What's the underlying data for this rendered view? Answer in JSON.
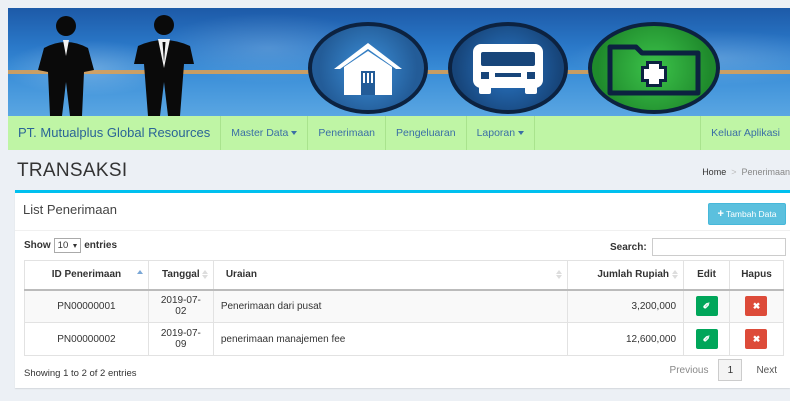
{
  "banner": {
    "icons": [
      "house-icon",
      "bus-icon",
      "folder-plus-icon"
    ],
    "colors": {
      "sky": "#2a78c8",
      "house_circle": "#235c98",
      "bus_circle": "#17457a",
      "folder_circle": "#1f8a2c",
      "ring": "#0c2240"
    }
  },
  "navbar": {
    "brand": "PT. Mutualplus Global Resources",
    "items": [
      {
        "label": "Master Data",
        "dropdown": true
      },
      {
        "label": "Penerimaan",
        "dropdown": false
      },
      {
        "label": "Pengeluaran",
        "dropdown": false
      },
      {
        "label": "Laporan",
        "dropdown": true
      }
    ],
    "logout": "Keluar Aplikasi",
    "background": "#bff5a5"
  },
  "header": {
    "title": "TRANSAKSI",
    "breadcrumb": {
      "home": "Home",
      "current": "Penerimaan"
    }
  },
  "box": {
    "title": "List Penerimaan",
    "add_button": "Tambah Data",
    "accent": "#00c0ef"
  },
  "table_controls": {
    "show_label": "Show",
    "entries_value": "10",
    "entries_label": "entries",
    "search_label": "Search:"
  },
  "table": {
    "columns": [
      "ID Penerimaan",
      "Tanggal",
      "Uraian",
      "Jumlah Rupiah",
      "Edit",
      "Hapus"
    ],
    "rows": [
      {
        "id": "PN00000001",
        "tanggal": "2019-07-02",
        "uraian": "Penerimaan dari pusat",
        "jumlah": "3,200,000"
      },
      {
        "id": "PN00000002",
        "tanggal": "2019-07-09",
        "uraian": "penerimaan manajemen fee",
        "jumlah": "12,600,000"
      }
    ],
    "edit_color": "#00a65a",
    "delete_color": "#dd4b39"
  },
  "footer": {
    "info": "Showing 1 to 2 of 2 entries",
    "previous": "Previous",
    "page": "1",
    "next": "Next"
  }
}
